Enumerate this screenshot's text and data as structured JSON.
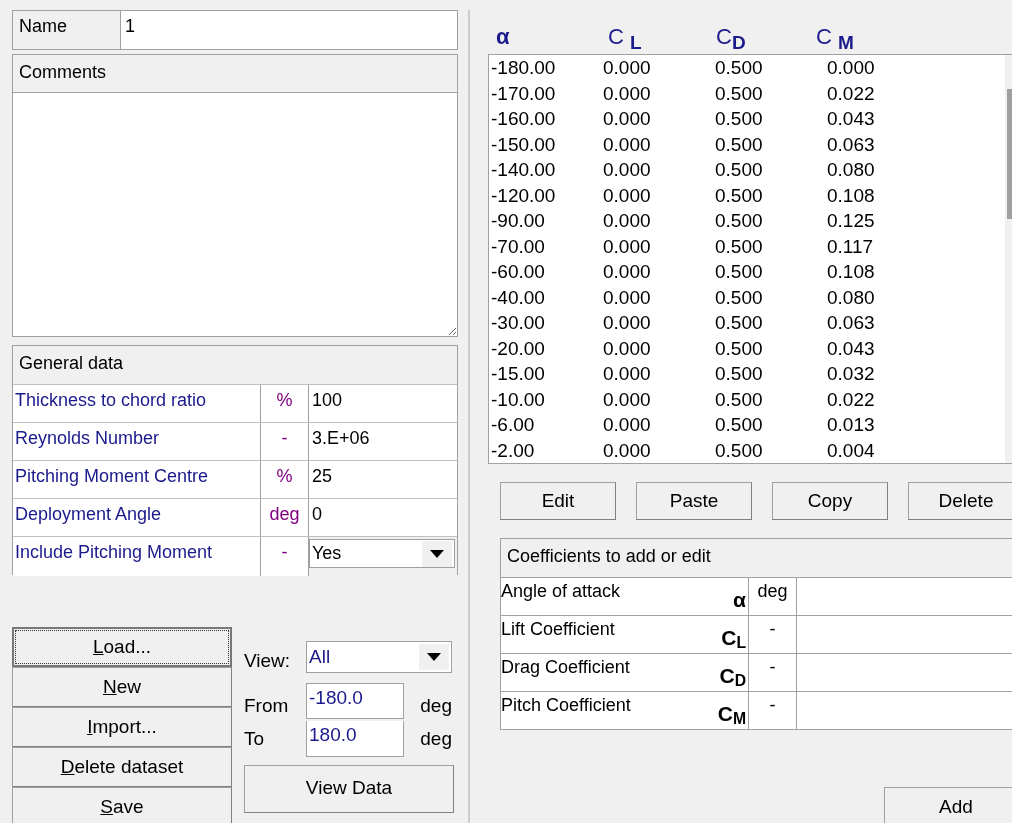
{
  "name_field": {
    "label": "Name",
    "value": "1"
  },
  "comments": {
    "label": "Comments"
  },
  "general_data": {
    "title": "General data",
    "rows": [
      {
        "label": "Thickness to chord ratio",
        "unit": "%",
        "value": "100",
        "kind": "text"
      },
      {
        "label": "Reynolds Number",
        "unit": "-",
        "value": "3.E+06",
        "kind": "text"
      },
      {
        "label": "Pitching Moment Centre",
        "unit": "%",
        "value": "25",
        "kind": "text"
      },
      {
        "label": "Deployment Angle",
        "unit": "deg",
        "value": "0",
        "kind": "text"
      },
      {
        "label": "Include Pitching Moment",
        "unit": "-",
        "value": "Yes",
        "kind": "dropdown"
      }
    ]
  },
  "dataset_buttons": [
    {
      "label": "Load...",
      "access_key": true,
      "focused": true
    },
    {
      "label": "New",
      "access_key": true,
      "focused": false
    },
    {
      "label": "Import...",
      "access_key": true,
      "focused": false
    },
    {
      "label": "Delete dataset",
      "access_key": true,
      "focused": false
    },
    {
      "label": "Save",
      "access_key": true,
      "focused": false
    }
  ],
  "view": {
    "label": "View:",
    "value": "All",
    "from_label": "From",
    "from_value": "-180.0",
    "from_unit": "deg",
    "to_label": "To",
    "to_value": "180.0",
    "to_unit": "deg",
    "button": "View Data"
  },
  "table": {
    "columns": [
      "α",
      "C $_{L}$",
      "C$_{D}$",
      "C $_{M}$"
    ],
    "rows": [
      [
        "-180.00",
        "0.000",
        "0.500",
        "0.000"
      ],
      [
        "-170.00",
        "0.000",
        "0.500",
        "0.022"
      ],
      [
        "-160.00",
        "0.000",
        "0.500",
        "0.043"
      ],
      [
        "-150.00",
        "0.000",
        "0.500",
        "0.063"
      ],
      [
        "-140.00",
        "0.000",
        "0.500",
        "0.080"
      ],
      [
        "-120.00",
        "0.000",
        "0.500",
        "0.108"
      ],
      [
        "-90.00",
        "0.000",
        "0.500",
        "0.125"
      ],
      [
        "-70.00",
        "0.000",
        "0.500",
        "0.117"
      ],
      [
        "-60.00",
        "0.000",
        "0.500",
        "0.108"
      ],
      [
        "-40.00",
        "0.000",
        "0.500",
        "0.080"
      ],
      [
        "-30.00",
        "0.000",
        "0.500",
        "0.063"
      ],
      [
        "-20.00",
        "0.000",
        "0.500",
        "0.043"
      ],
      [
        "-15.00",
        "0.000",
        "0.500",
        "0.032"
      ],
      [
        "-10.00",
        "0.000",
        "0.500",
        "0.022"
      ],
      [
        "-6.00",
        "0.000",
        "0.500",
        "0.013"
      ],
      [
        "-2.00",
        "0.000",
        "0.500",
        "0.004"
      ]
    ]
  },
  "table_buttons": [
    "Edit",
    "Paste",
    "Copy",
    "Delete"
  ],
  "coefficients": {
    "title": "Coefficients to add or edit",
    "rows": [
      {
        "label": "Angle of attack",
        "symbol": "α",
        "unit": "deg"
      },
      {
        "label": "Lift Coefficient",
        "symbol": "C$_{L}$",
        "unit": "-"
      },
      {
        "label": "Drag Coefficient",
        "symbol": "C$_{D}$",
        "unit": "-"
      },
      {
        "label": "Pitch Coefficient",
        "symbol": "C$_{M}$",
        "unit": "-"
      }
    ]
  },
  "add_button": "Add"
}
